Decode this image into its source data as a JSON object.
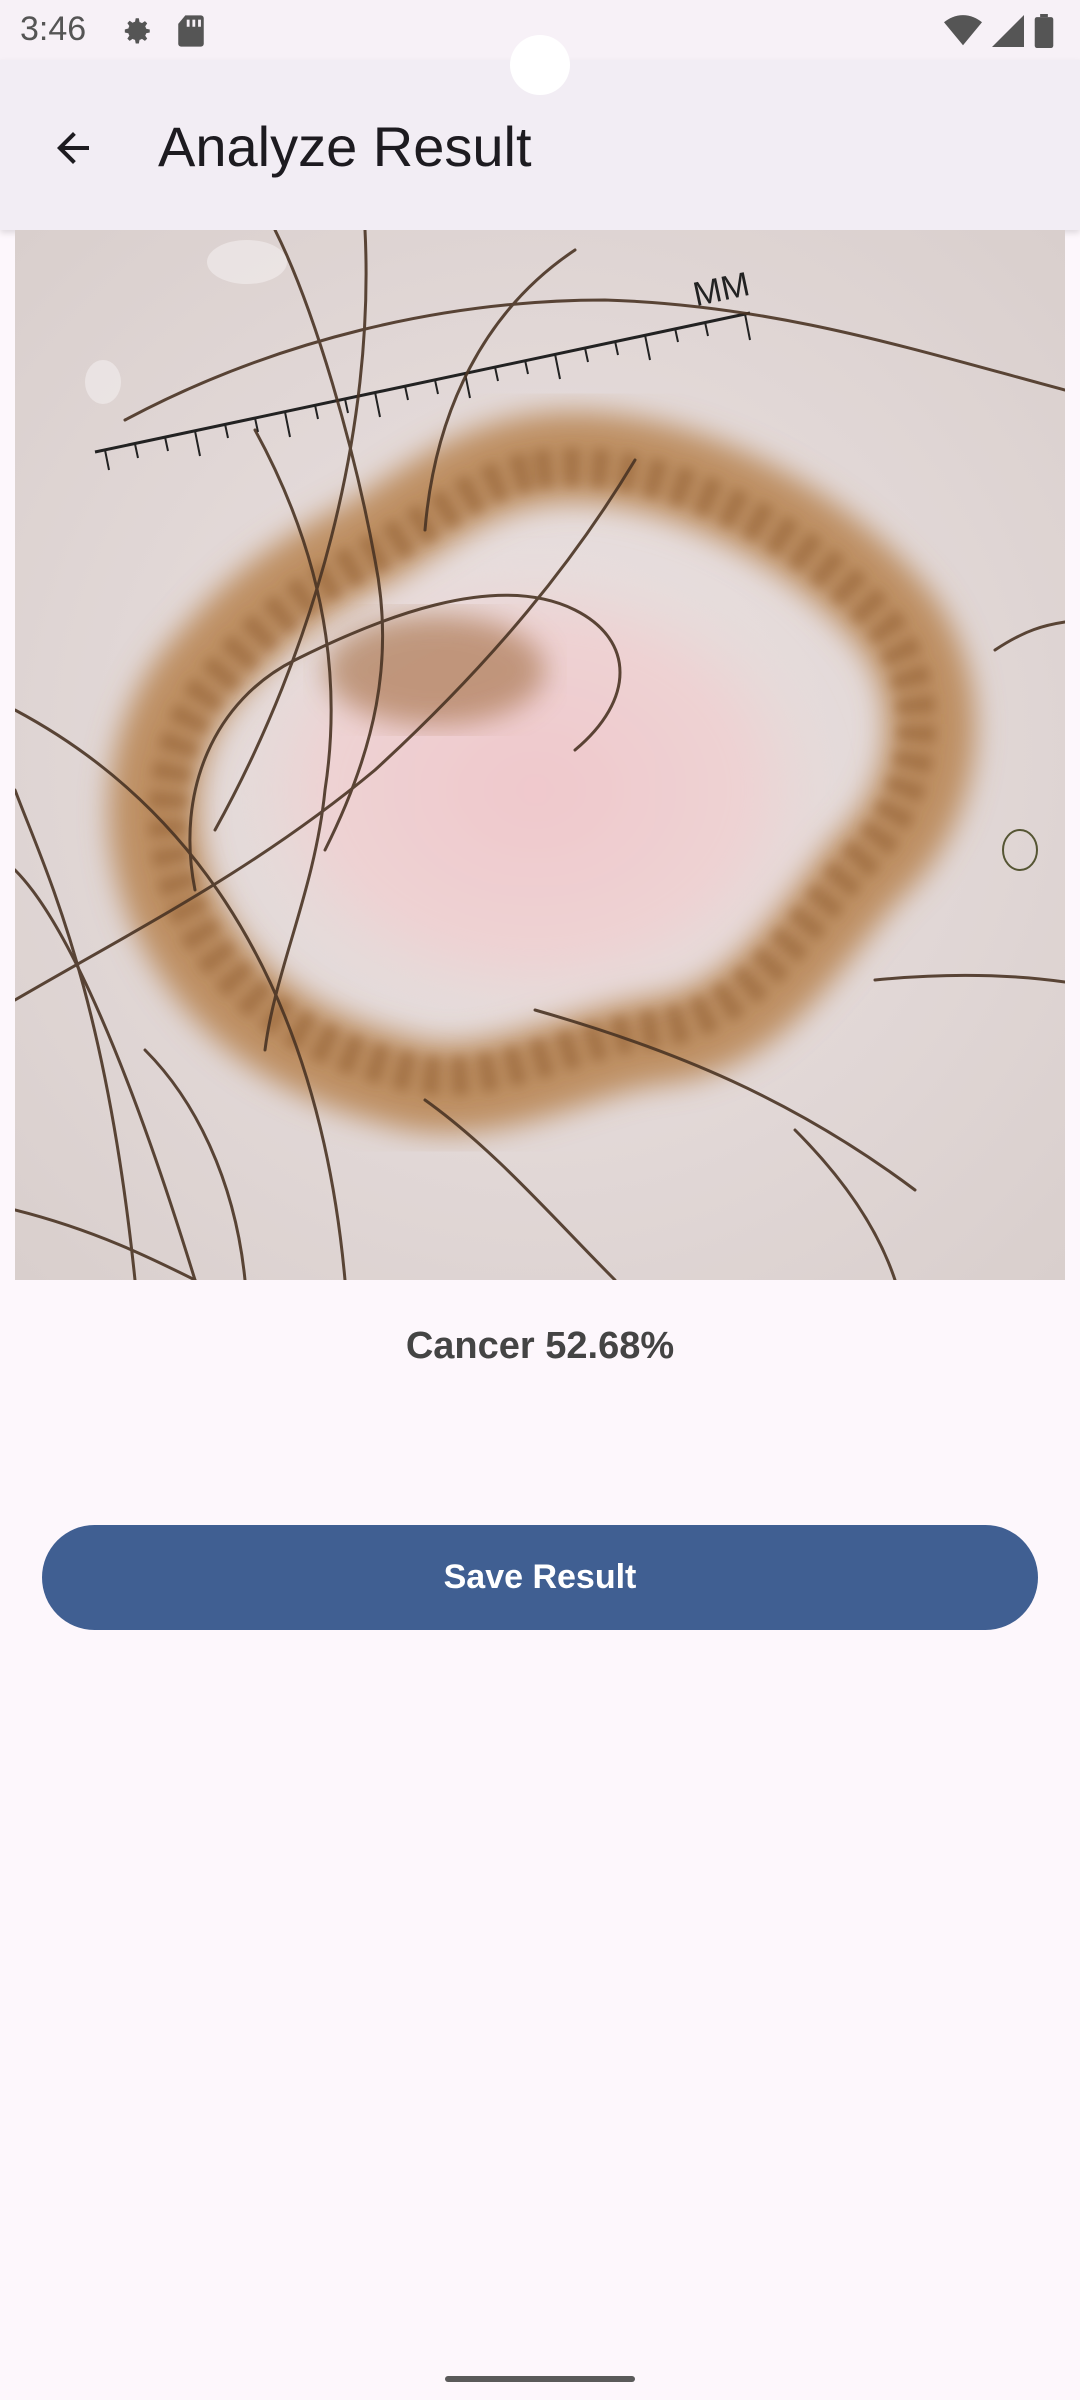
{
  "status_bar": {
    "time": "3:46",
    "left_icons": [
      "gear-icon",
      "sd-card-icon"
    ],
    "right_icons": [
      "wifi-icon",
      "cellular-signal-icon",
      "battery-icon"
    ]
  },
  "app_bar": {
    "title": "Analyze Result",
    "back_icon": "arrow-back-icon"
  },
  "result": {
    "image_ruler_label": "MM",
    "text": "Cancer 52.68%"
  },
  "actions": {
    "save_label": "Save Result"
  },
  "colors": {
    "background": "#fdf7fc",
    "app_bar": "#f2edf4",
    "button": "#405f92",
    "button_text": "#ffffff",
    "title_text": "#1d1b20"
  }
}
